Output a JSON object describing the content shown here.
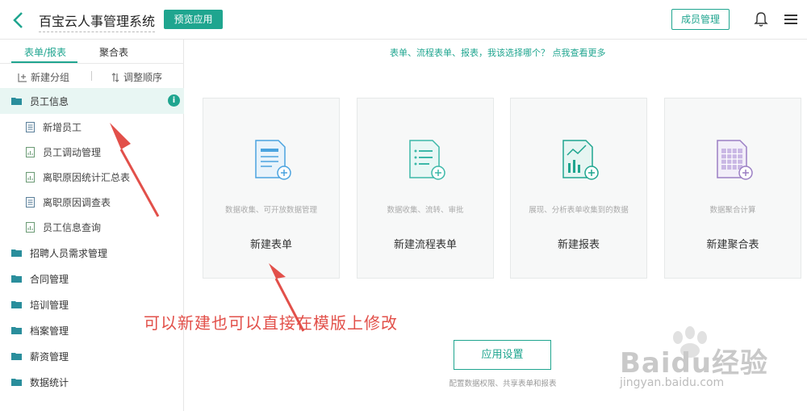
{
  "topbar": {
    "app_title": "百宝云人事管理系统",
    "preview_label": "预览应用",
    "member_label": "成员管理"
  },
  "sidebar": {
    "tabs": [
      "表单/报表",
      "聚合表"
    ],
    "new_group": "新建分组",
    "reorder": "调整顺序",
    "active_group": "员工信息",
    "sub_items": [
      "新增员工",
      "员工调动管理",
      "离职原因统计汇总表",
      "离职原因调查表",
      "员工信息查询"
    ],
    "groups": [
      "招聘人员需求管理",
      "合同管理",
      "培训管理",
      "档案管理",
      "薪资管理",
      "数据统计"
    ]
  },
  "main": {
    "help_link": "表单、流程表单、报表，我该选择哪个？ 点我查看更多",
    "cards": [
      {
        "desc": "数据收集、可开放数据管理",
        "title": "新建表单",
        "color": "#4aa3df"
      },
      {
        "desc": "数据收集、流转、审批",
        "title": "新建流程表单",
        "color": "#3cb8a8"
      },
      {
        "desc": "展现、分析表单收集到的数据",
        "title": "新建报表",
        "color": "#1fa58f"
      },
      {
        "desc": "数据聚合计算",
        "title": "新建聚合表",
        "color": "#9b7fc4"
      }
    ],
    "settings_label": "应用设置",
    "settings_desc": "配置数据权限、共享表单和报表"
  },
  "annotation": "可以新建也可以直接在模版上修改",
  "watermark": {
    "brand": "Baidu经验",
    "url": "jingyan.baidu.com"
  },
  "accent_color": "#1fa58f"
}
